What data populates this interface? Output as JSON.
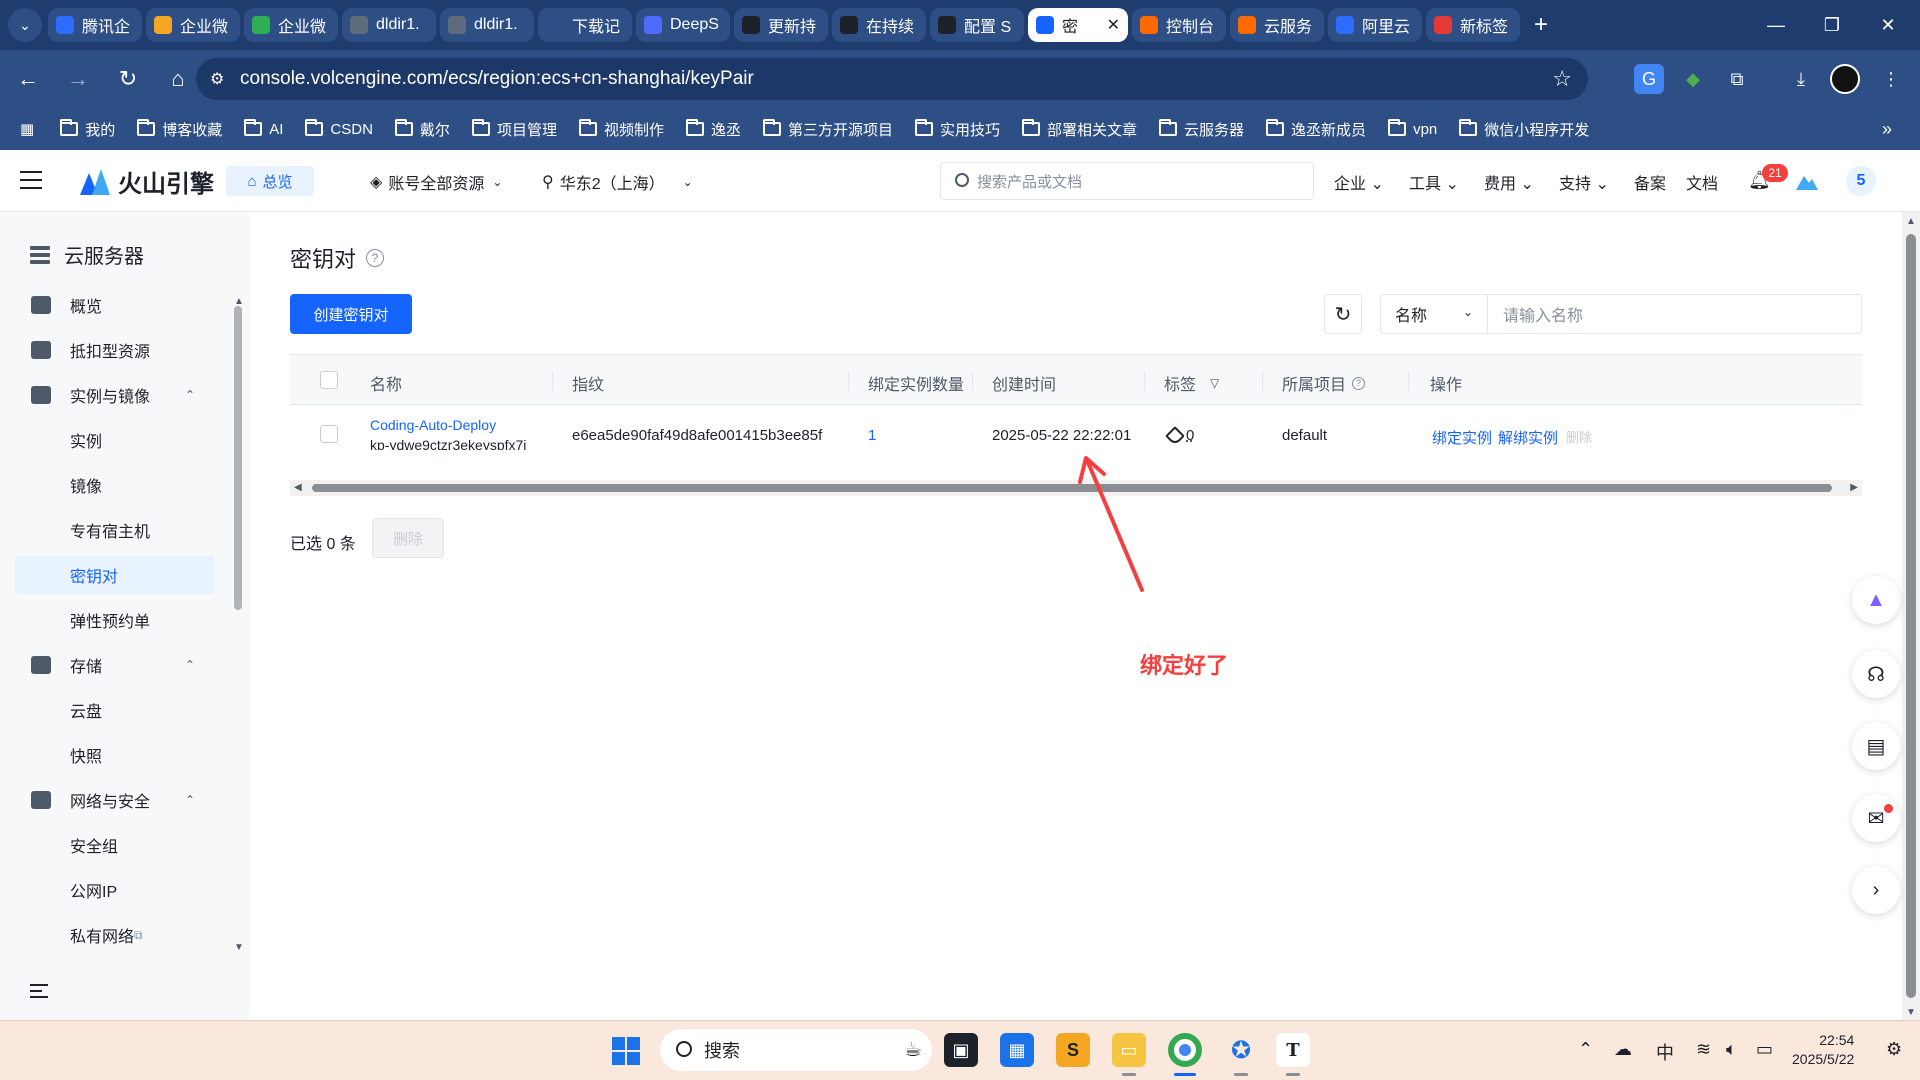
{
  "browser": {
    "tabs": [
      {
        "label": "腾讯企",
        "icon": "tencent-icon",
        "color": "#2f6bff"
      },
      {
        "label": "企业微",
        "icon": "wecom-icon",
        "color": "#f5a623"
      },
      {
        "label": "企业微",
        "icon": "wecom-green-icon",
        "color": "#2fae54"
      },
      {
        "label": "dldir1.",
        "icon": "globe-icon",
        "color": "#5f6b7a"
      },
      {
        "label": "dldir1.",
        "icon": "globe-icon",
        "color": "#5f6b7a"
      },
      {
        "label": "下载记",
        "icon": "download-icon",
        "color": "#2e4f86"
      },
      {
        "label": "DeepS",
        "icon": "deepseek-icon",
        "color": "#4d6bfe"
      },
      {
        "label": "更新持",
        "icon": "chatgpt-icon",
        "color": "#1d2129"
      },
      {
        "label": "在持续",
        "icon": "ollama-icon",
        "color": "#1d2129"
      },
      {
        "label": "配置 S",
        "icon": "ollama-icon",
        "color": "#1d2129"
      },
      {
        "label": "密",
        "icon": "volcengine-icon",
        "color": "#1664ff",
        "active": true
      },
      {
        "label": "控制台",
        "icon": "aliyun-icon",
        "color": "#ff6a00"
      },
      {
        "label": "云服务",
        "icon": "aliyun-icon",
        "color": "#ff6a00"
      },
      {
        "label": "阿里云",
        "icon": "baidu-icon",
        "color": "#2f6bff"
      },
      {
        "label": "新标签",
        "icon": "infinity-icon",
        "color": "#e53935"
      }
    ],
    "url": "console.volcengine.com/ecs/region:ecs+cn-shanghai/keyPair",
    "bookmarks": [
      "我的",
      "博客收藏",
      "AI",
      "CSDN",
      "戴尔",
      "项目管理",
      "视频制作",
      "逸丞",
      "第三方开源项目",
      "实用技巧",
      "部署相关文章",
      "云服务器",
      "逸丞新成员",
      "vpn",
      "微信小程序开发"
    ]
  },
  "header": {
    "brand": "火山引擎",
    "overview": "总览",
    "account_scope": "账号全部资源",
    "region": "华东2（上海）",
    "search_placeholder": "搜索产品或文档",
    "menus": [
      "企业",
      "工具",
      "费用",
      "支持",
      "备案",
      "文档"
    ],
    "notification_count": "21",
    "avatar_text": "5"
  },
  "sidebar": {
    "title": "云服务器",
    "items": [
      {
        "label": "概览",
        "type": "top"
      },
      {
        "label": "抵扣型资源",
        "type": "top"
      },
      {
        "label": "实例与镜像",
        "type": "group"
      },
      {
        "label": "实例",
        "type": "sub"
      },
      {
        "label": "镜像",
        "type": "sub"
      },
      {
        "label": "专有宿主机",
        "type": "sub"
      },
      {
        "label": "密钥对",
        "type": "sub",
        "active": true
      },
      {
        "label": "弹性预约单",
        "type": "sub"
      },
      {
        "label": "存储",
        "type": "group"
      },
      {
        "label": "云盘",
        "type": "sub"
      },
      {
        "label": "快照",
        "type": "sub"
      },
      {
        "label": "网络与安全",
        "type": "group"
      },
      {
        "label": "安全组",
        "type": "sub"
      },
      {
        "label": "公网IP",
        "type": "sub"
      },
      {
        "label": "私有网络",
        "type": "sub"
      }
    ]
  },
  "main": {
    "title": "密钥对",
    "create_button": "创建密钥对",
    "filter_field": "名称",
    "filter_placeholder": "请输入名称",
    "columns": [
      "名称",
      "指纹",
      "绑定实例数量",
      "创建时间",
      "标签",
      "所属项目",
      "操作"
    ],
    "rows": [
      {
        "name": "Coding-Auto-Deploy",
        "id": "kp-ydwe9ctzr3ekeyspfx7j",
        "fingerprint": "e6ea5de90faf49d8afe001415b3ee85f",
        "bound_count": "1",
        "created": "2025-05-22 22:22:01",
        "tags": "0",
        "project": "default",
        "actions": [
          "绑定实例",
          "解绑实例",
          "删除"
        ]
      }
    ],
    "selected_text": "已选 0 条",
    "delete_button": "删除",
    "annotation": "绑定好了"
  },
  "taskbar": {
    "search": "搜索",
    "ime": "中",
    "time": "22:54",
    "date": "2025/5/22"
  },
  "colors": {
    "primary": "#1664ff",
    "annotation": "#f53f3f",
    "chrome": "#2e4f86"
  }
}
